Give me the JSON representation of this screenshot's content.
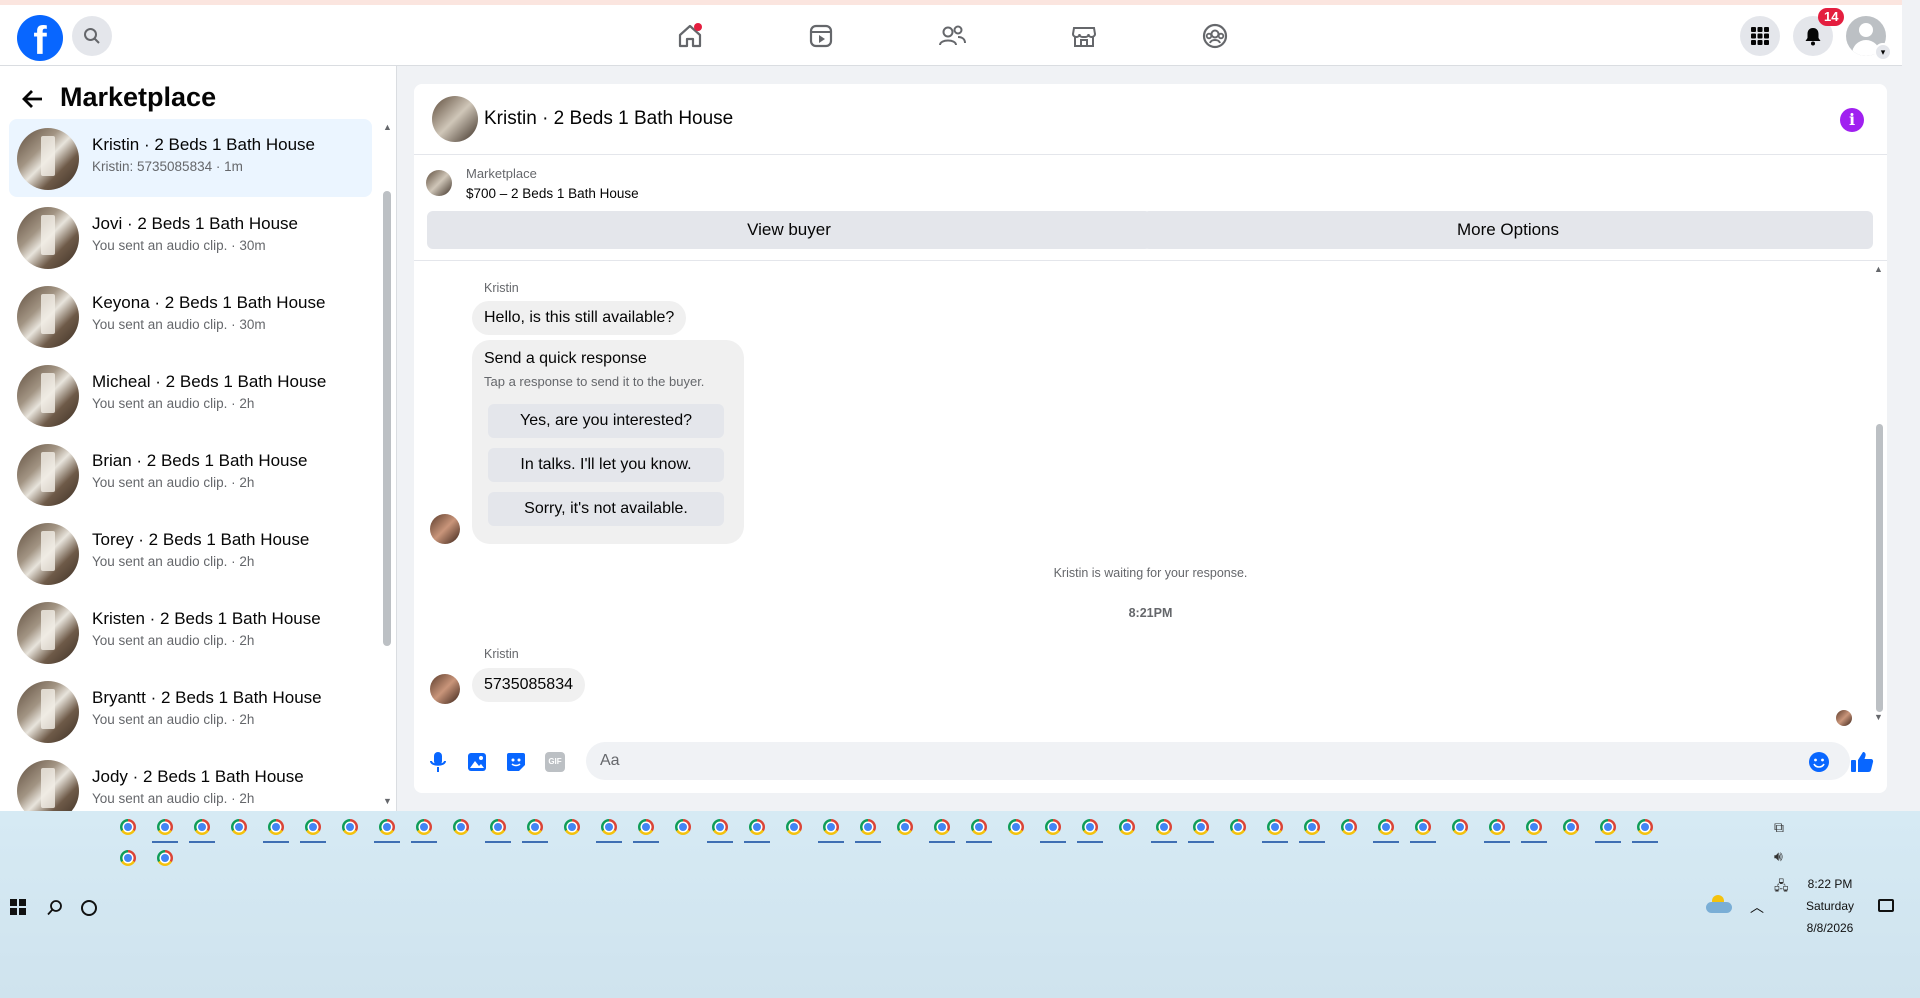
{
  "app": "Facebook Marketplace",
  "topnav": {
    "logo": "f",
    "notification_count": "14",
    "icons": [
      "search-icon",
      "home-icon",
      "video-icon",
      "friends-icon",
      "marketplace-icon",
      "groups-icon",
      "menu-grid-icon",
      "bell-icon",
      "profile-avatar"
    ]
  },
  "left": {
    "title": "Marketplace",
    "threads": [
      {
        "name": "Kristin · 2 Beds 1 Bath House",
        "sub": "Kristin: 5735085834 · 1m",
        "active": true
      },
      {
        "name": "Jovi · 2 Beds 1 Bath House",
        "sub": "You sent an audio clip. · 30m"
      },
      {
        "name": "Keyona · 2 Beds 1 Bath House",
        "sub": "You sent an audio clip. · 30m"
      },
      {
        "name": "Micheal · 2 Beds 1 Bath House",
        "sub": "You sent an audio clip. · 2h"
      },
      {
        "name": "Brian · 2 Beds 1 Bath House",
        "sub": "You sent an audio clip. · 2h"
      },
      {
        "name": "Torey · 2 Beds 1 Bath House",
        "sub": "You sent an audio clip. · 2h"
      },
      {
        "name": "Kristen · 2 Beds 1 Bath House",
        "sub": "You sent an audio clip. · 2h"
      },
      {
        "name": "Bryantt · 2 Beds 1 Bath House",
        "sub": "You sent an audio clip. · 2h"
      },
      {
        "name": "Jody · 2 Beds 1 Bath House",
        "sub": "You sent an audio clip. · 2h"
      }
    ]
  },
  "chat": {
    "header_title": "Kristin · 2 Beds 1 Bath House",
    "listing_label": "Marketplace",
    "listing_price": "$700 – 2 Beds 1 Bath House",
    "view_buyer": "View buyer",
    "more_options": "More Options",
    "sender1": "Kristin",
    "msg1": "Hello, is this still available?",
    "quick_title": "Send a quick response",
    "quick_sub": "Tap a response to send it to the buyer.",
    "quick_options": [
      "Yes, are you interested?",
      "In talks. I'll let you know.",
      "Sorry, it's not available."
    ],
    "waiting": "Kristin is waiting for your response.",
    "time": "8:21PM",
    "sender2": "Kristin",
    "msg2": "5735085834",
    "composer_placeholder": "Aa",
    "composer_icons": [
      "mic-icon",
      "photo-icon",
      "sticker-icon",
      "gif-icon",
      "emoji-icon",
      "thumbs-up-icon"
    ]
  },
  "taskbar": {
    "clock_time": "8:22 PM",
    "clock_day": "Saturday",
    "clock_date": "8/8/2026",
    "gif_label": "GIF"
  }
}
